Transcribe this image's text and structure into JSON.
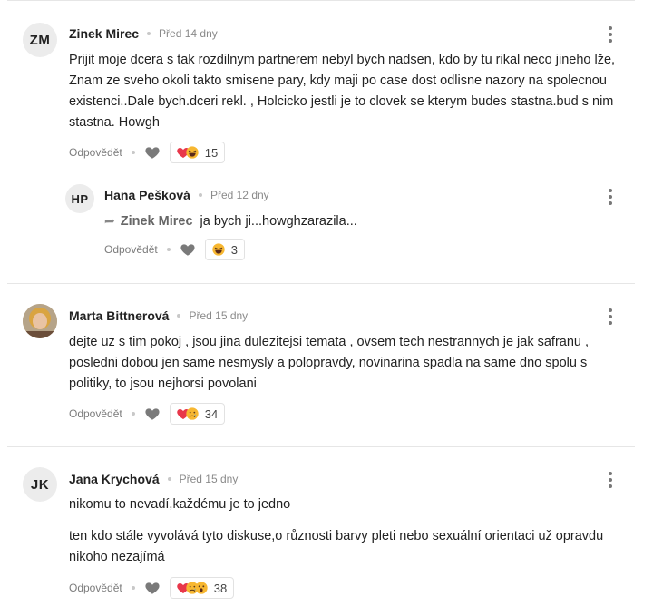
{
  "action_label": "Odpovědět",
  "comments": [
    {
      "initials": "ZM",
      "author": "Zinek Mirec",
      "time": "Před 14 dny",
      "text": "Prijit moje dcera s tak rozdilnym partnerem nebyl bych nadsen, kdo by tu rikal neco jineho lže, Znam ze sveho okoli takto smisene pary, kdy maji po case dost odlisne nazory na spolecnou existenci..Dale bych.dceri rekl. , Holcicko jestli je to clovek se kterym budes stastna.bud s nim stastna. Howgh",
      "reaction_count": "15"
    },
    {
      "initials": "HP",
      "author": "Hana Pešková",
      "time": "Před 12 dny",
      "reply_to": "Zinek Mirec",
      "text": "ja bych ji...howghzarazila...",
      "reaction_count": "3"
    },
    {
      "author": "Marta Bittnerová",
      "time": "Před 15 dny",
      "text": "dejte uz s tim pokoj , jsou jina dulezitejsi temata , ovsem tech nestrannych je jak safranu , posledni dobou jen same nesmysly a polopravdy, novinarina spadla na same dno spolu s politiky, to jsou nejhorsi povolani",
      "reaction_count": "34"
    },
    {
      "initials": "JK",
      "author": "Jana Krychová",
      "time": "Před 15 dny",
      "text_p1": "nikomu to nevadí,každému je to jedno",
      "text_p2": "ten kdo stále vyvolává tyto diskuse,o různosti barvy pleti nebo sexuální orientaci už opravdu nikoho nezajímá",
      "reaction_count": "38"
    }
  ]
}
